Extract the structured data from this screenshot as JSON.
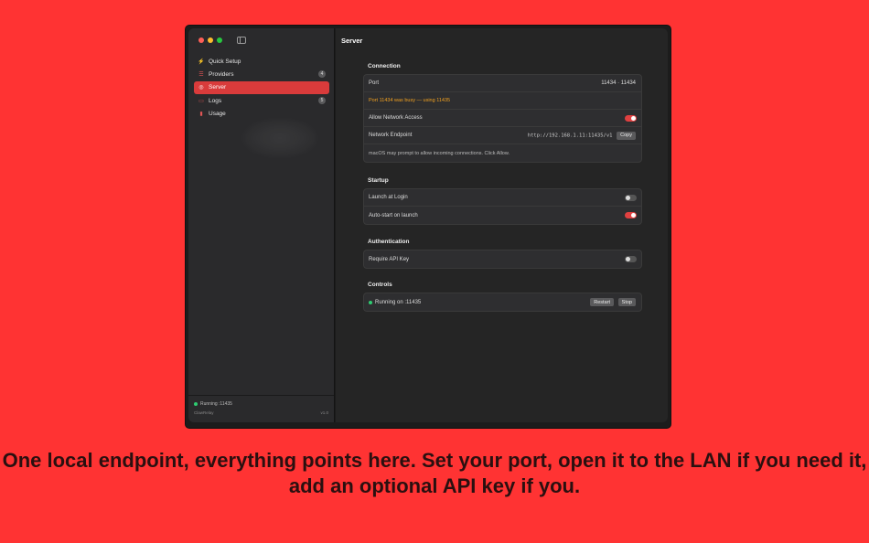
{
  "sidebar": {
    "items": [
      {
        "label": "Quick Setup",
        "icon": "bolt-icon",
        "badge": ""
      },
      {
        "label": "Providers",
        "icon": "server-stack-icon",
        "badge": "4"
      },
      {
        "label": "Server",
        "icon": "globe-icon",
        "badge": ""
      },
      {
        "label": "Logs",
        "icon": "terminal-icon",
        "badge": "5"
      },
      {
        "label": "Usage",
        "icon": "bar-chart-icon",
        "badge": ""
      }
    ],
    "active": "Server",
    "status": "Running :11435",
    "app_name": "ClawRelay",
    "version": "v1.0"
  },
  "main": {
    "title": "Server",
    "connection": {
      "title": "Connection",
      "port_label": "Port",
      "port_value": "11434 · 11434",
      "port_warning": "Port 11434 was busy — using 11435",
      "network_access_label": "Allow Network Access",
      "network_access_on": true,
      "endpoint_label": "Network Endpoint",
      "endpoint_value": "http://192.168.1.11:11435/v1",
      "copy_label": "Copy",
      "hint": "macOS may prompt to allow incoming connections. Click Allow."
    },
    "startup": {
      "title": "Startup",
      "launch_login_label": "Launch at Login",
      "launch_login_on": false,
      "autostart_label": "Auto-start on launch",
      "autostart_on": true
    },
    "auth": {
      "title": "Authentication",
      "require_key_label": "Require API Key",
      "require_key_on": false
    },
    "controls": {
      "title": "Controls",
      "status": "Running on :11435",
      "restart_label": "Restart",
      "stop_label": "Stop"
    }
  },
  "caption": "One local endpoint, everything points here. Set your port, open it to the LAN if you need it, add an optional API key if you.",
  "colors": {
    "background": "#ff3333",
    "accent": "#d93b3b",
    "running": "#2ecc71",
    "warning": "#f0a020"
  }
}
